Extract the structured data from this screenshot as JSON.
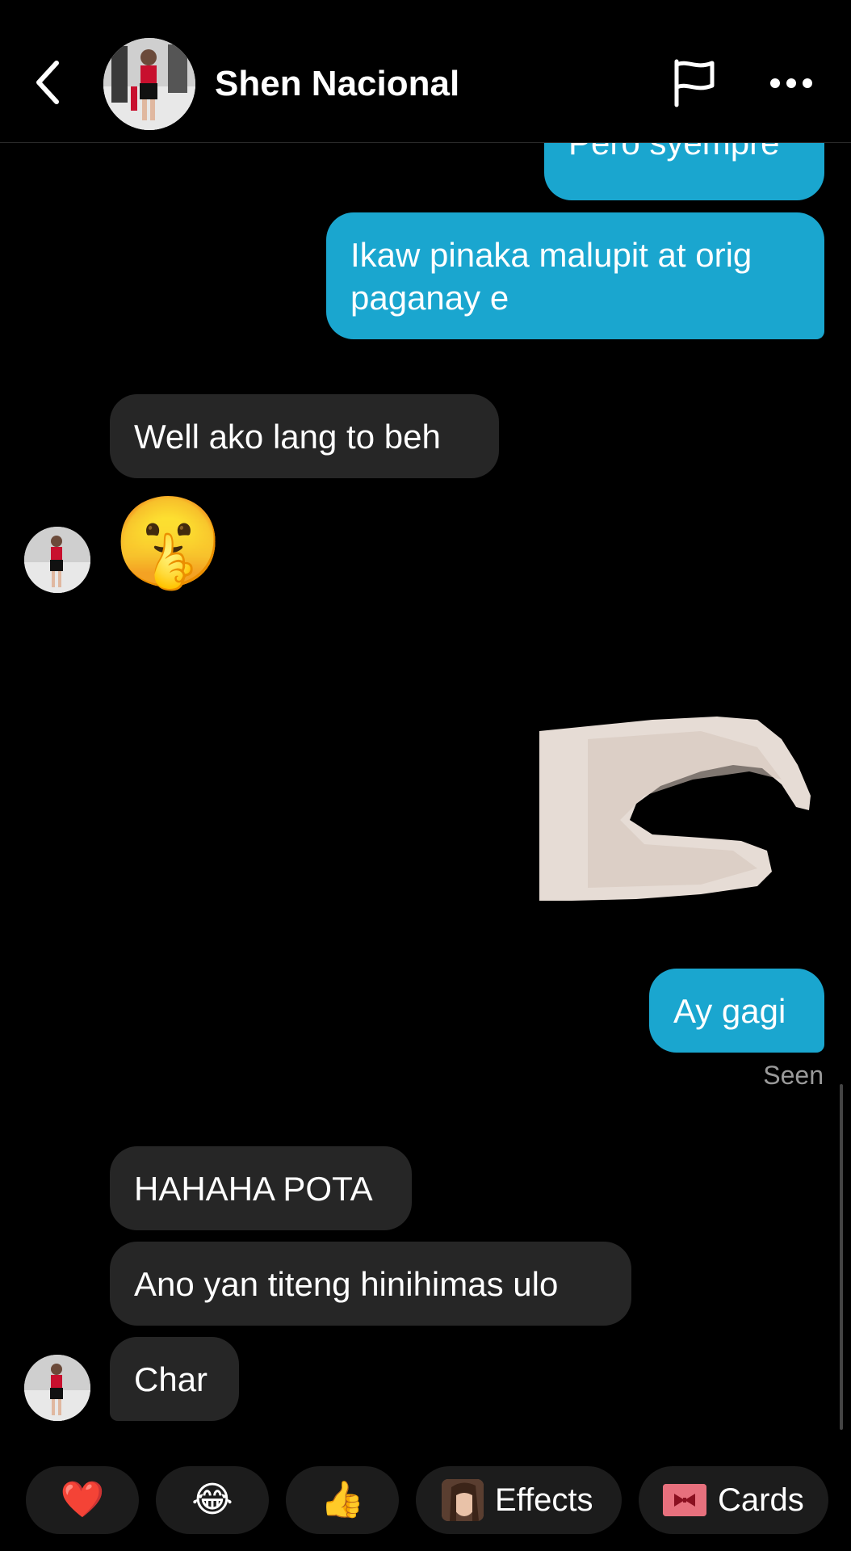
{
  "header": {
    "contact_name": "Shen Nacional"
  },
  "messages": {
    "m1": "Pero syempre",
    "m2": "Ikaw pinaka malupit at orig paganay e",
    "m3": "Well ako lang to beh",
    "m4": "🤫",
    "m5": "Ay gagi",
    "seen": "Seen",
    "m6": "HAHAHA POTA",
    "m7": "Ano yan titeng hinihimas ulo",
    "m8": "Char"
  },
  "quick_actions": {
    "heart": "❤️",
    "laugh": "😂",
    "thumbs": "👍",
    "effects": "Effects",
    "cards": "Cards"
  },
  "colors": {
    "outgoing_bubble": "#1aa6cf",
    "incoming_bubble": "#262626",
    "background": "#000000"
  },
  "icons": [
    "back-chevron-icon",
    "flag-icon",
    "more-icon"
  ]
}
